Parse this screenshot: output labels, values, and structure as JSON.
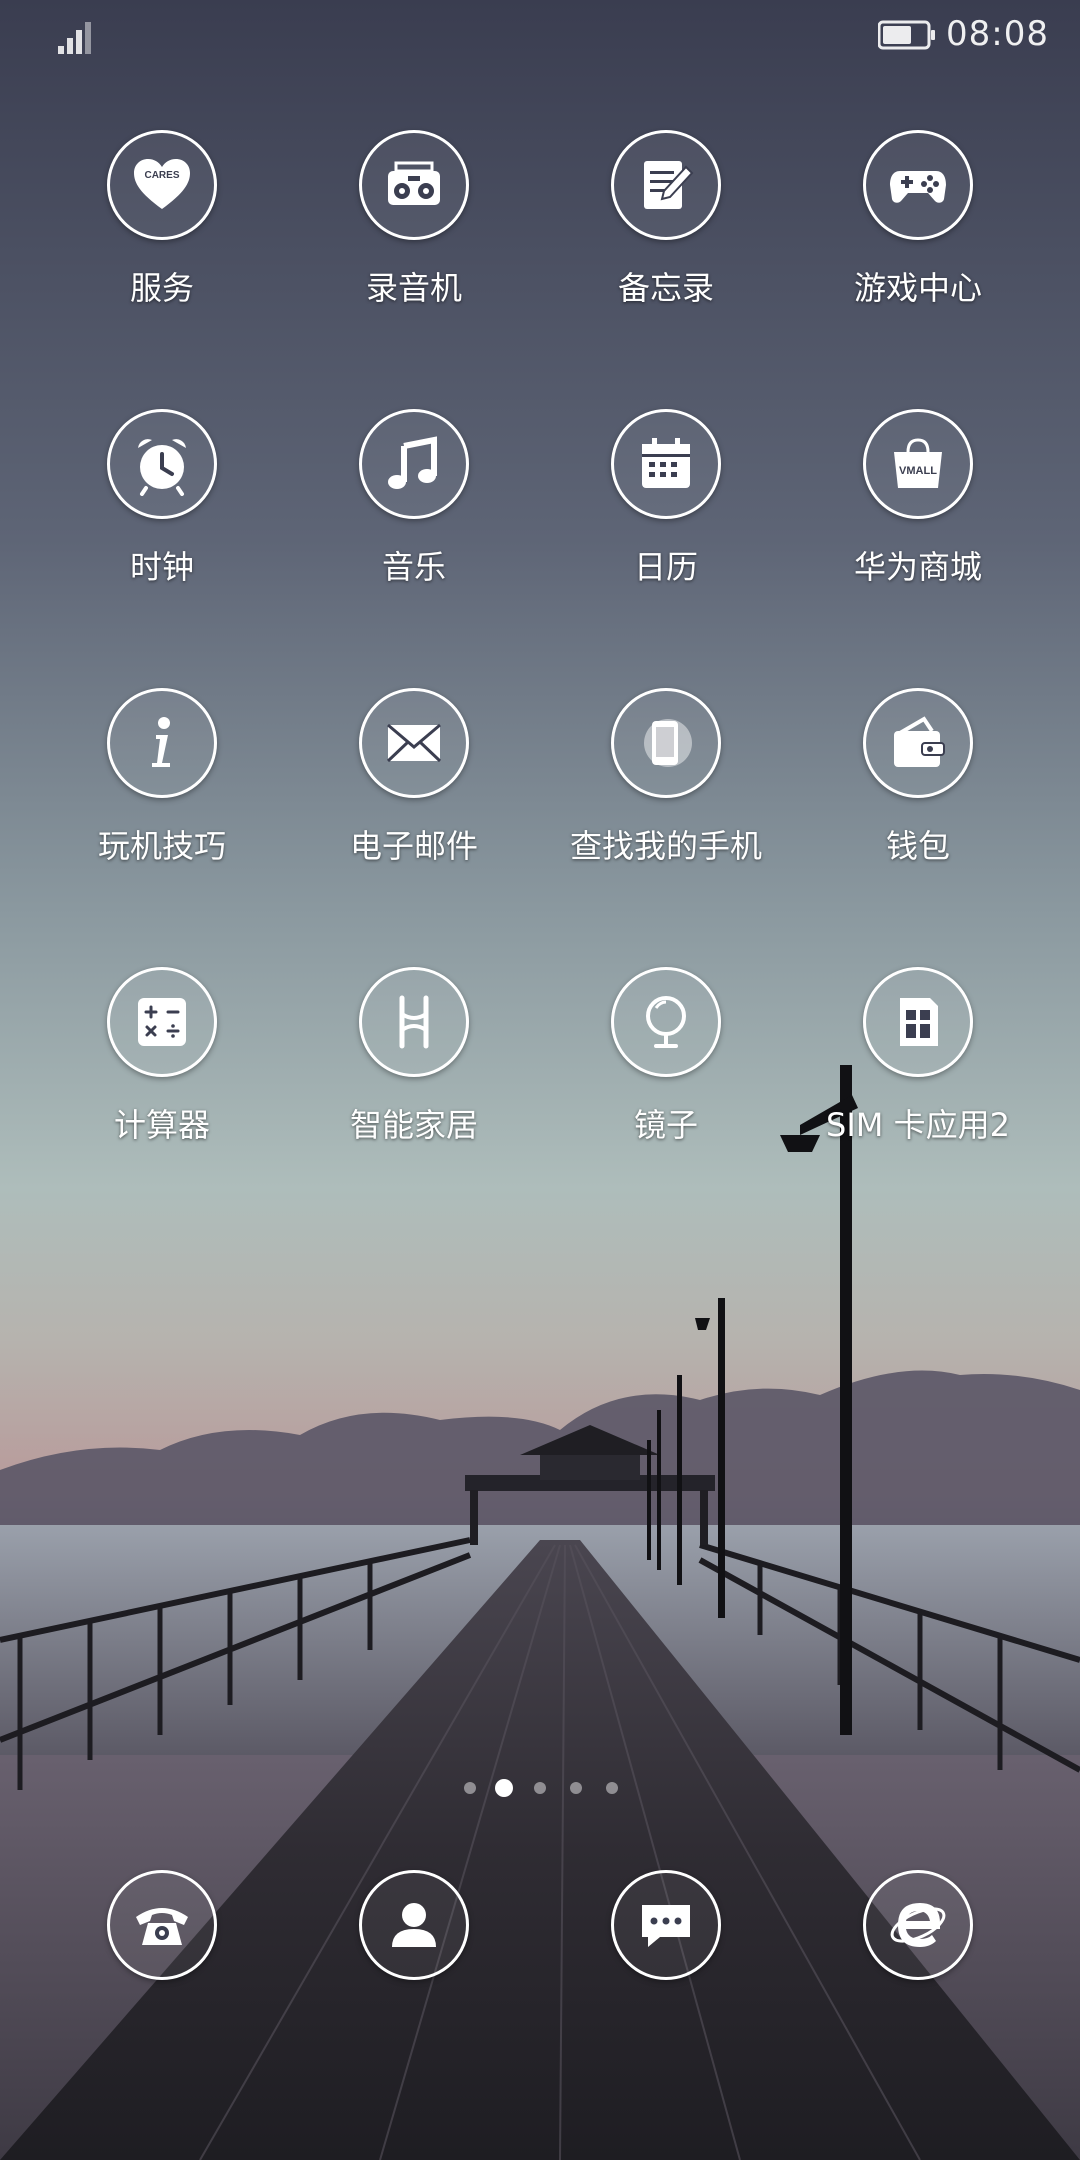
{
  "status_bar": {
    "time": "08:08",
    "signal_icon": "signal-icon",
    "battery_icon": "battery-icon"
  },
  "home": {
    "rows": [
      [
        {
          "label": "服务",
          "icon": "cares-heart-icon"
        },
        {
          "label": "录音机",
          "icon": "radio-recorder-icon"
        },
        {
          "label": "备忘录",
          "icon": "notepad-icon"
        },
        {
          "label": "游戏中心",
          "icon": "gamepad-icon"
        }
      ],
      [
        {
          "label": "时钟",
          "icon": "alarm-clock-icon"
        },
        {
          "label": "音乐",
          "icon": "music-note-icon"
        },
        {
          "label": "日历",
          "icon": "calendar-icon"
        },
        {
          "label": "华为商城",
          "icon": "vmall-bag-icon"
        }
      ],
      [
        {
          "label": "玩机技巧",
          "icon": "info-icon"
        },
        {
          "label": "电子邮件",
          "icon": "mail-icon"
        },
        {
          "label": "查找我的手机",
          "icon": "find-phone-icon"
        },
        {
          "label": "钱包",
          "icon": "wallet-icon"
        }
      ],
      [
        {
          "label": "计算器",
          "icon": "calculator-icon"
        },
        {
          "label": "智能家居",
          "icon": "smart-home-icon"
        },
        {
          "label": "镜子",
          "icon": "mirror-icon"
        },
        {
          "label": "SIM 卡应用2",
          "icon": "sim-card-icon"
        }
      ]
    ],
    "badge_text": {
      "cares": "CARES",
      "vmall": "VMALL"
    }
  },
  "page_indicator": {
    "count": 5,
    "active_index": 1
  },
  "dock": [
    {
      "icon": "phone-icon"
    },
    {
      "icon": "contacts-icon"
    },
    {
      "icon": "messages-icon"
    },
    {
      "icon": "browser-icon"
    }
  ],
  "colors": {
    "sky_top": "#3c4054",
    "sky_mid": "#8a9aa3",
    "sky_low": "#b6c6c4",
    "horizon_pink": "#b59595",
    "pier": "#2c2a2f"
  }
}
